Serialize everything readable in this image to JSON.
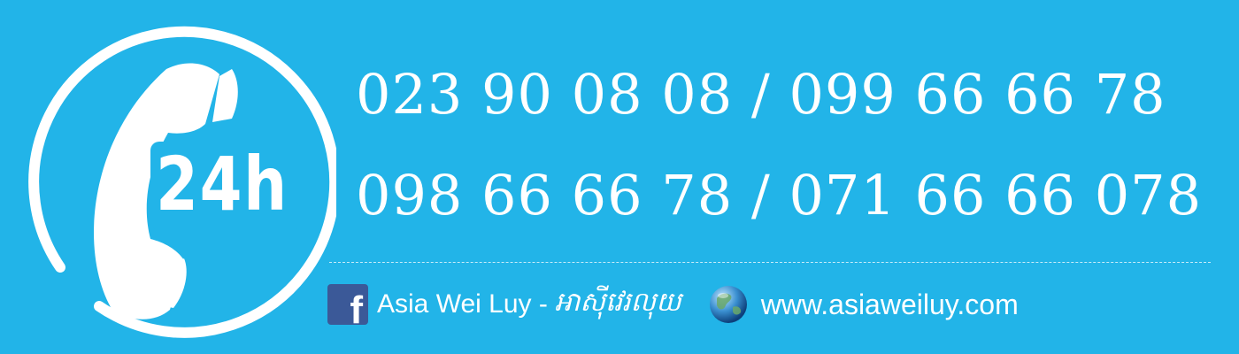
{
  "badge": {
    "text": "24h",
    "icon": "phone-handset-icon"
  },
  "phones": {
    "line1": "023 90 08 08 / 099 66 66 78",
    "line2": "098 66 66 78 / 071 66 66 078"
  },
  "footer": {
    "facebook_icon": "facebook-icon",
    "facebook_name": "Asia Wei Luy -",
    "facebook_khmer": "អាស៊ីវេរលុយ",
    "globe_icon": "globe-icon",
    "website": "www.asiaweiluy.com"
  },
  "colors": {
    "background": "#22b4e8",
    "text": "#ffffff",
    "facebook": "#3b5998"
  }
}
